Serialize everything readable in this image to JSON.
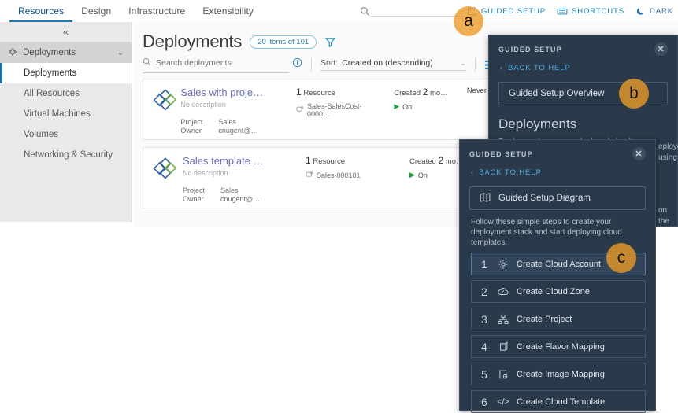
{
  "topnav": {
    "tabs": [
      {
        "label": "Resources",
        "active": true
      },
      {
        "label": "Design",
        "active": false
      },
      {
        "label": "Infrastructure",
        "active": false
      },
      {
        "label": "Extensibility",
        "active": false
      }
    ],
    "search_placeholder": "",
    "guided_setup_label": "GUIDED SETUP",
    "shortcuts_label": "SHORTCUTS",
    "dark_label": "DARK"
  },
  "sidebar": {
    "collapse_glyph": "«",
    "group": {
      "label": "Deployments",
      "caret": "⌄"
    },
    "items": [
      {
        "label": "Deployments",
        "active": true
      },
      {
        "label": "All Resources",
        "active": false
      },
      {
        "label": "Virtual Machines",
        "active": false
      },
      {
        "label": "Volumes",
        "active": false
      },
      {
        "label": "Networking & Security",
        "active": false
      }
    ]
  },
  "main": {
    "title": "Deployments",
    "count_pill": "20 items of 101",
    "search_placeholder": "Search deployments",
    "sort_label": "Sort:",
    "sort_value": "Created on (descending)",
    "cards": [
      {
        "title": "Sales with proje…",
        "description": "No description",
        "project_key": "Project",
        "project_value": "Sales",
        "owner_key": "Owner",
        "owner_value": "cnugent@…",
        "resource_count": "1",
        "resource_label": "Resource",
        "resource_name": "Sales-SalesCost-0000…",
        "created_label_pre": "Created",
        "created_value": "2",
        "created_label_post": "mo…",
        "power_state": "On",
        "expires": "Never exp"
      },
      {
        "title": "Sales template …",
        "description": "No description",
        "project_key": "Project",
        "project_value": "Sales",
        "owner_key": "Owner",
        "owner_value": "cnugent@…",
        "resource_count": "1",
        "resource_label": "Resource",
        "resource_name": "Sales-000101",
        "created_label_pre": "Created",
        "created_value": "2",
        "created_label_post": "mo…",
        "power_state": "On",
        "expires": ""
      }
    ]
  },
  "panel_b": {
    "header": "GUIDED SETUP",
    "close": "✕",
    "back": "BACK TO HELP",
    "overview_button": "Guided Setup Overview",
    "heading": "Deployments",
    "body": "Deployments are your deployed cloud"
  },
  "panel_c": {
    "header": "GUIDED SETUP",
    "close": "✕",
    "back": "BACK TO HELP",
    "diagram_button": "Guided Setup Diagram",
    "intro": "Follow these simple steps to create your deployment stack and start deploying cloud templates.",
    "steps": [
      {
        "num": "1",
        "label": "Create Cloud Account",
        "icon": "gear-icon",
        "highlight": true
      },
      {
        "num": "2",
        "label": "Create Cloud Zone",
        "icon": "cloud-icon",
        "highlight": false
      },
      {
        "num": "3",
        "label": "Create Project",
        "icon": "org-chart-icon",
        "highlight": false
      },
      {
        "num": "4",
        "label": "Create Flavor Mapping",
        "icon": "flavor-icon",
        "highlight": false
      },
      {
        "num": "5",
        "label": "Create Image Mapping",
        "icon": "image-gear-icon",
        "highlight": false
      },
      {
        "num": "6",
        "label": "Create Cloud Template",
        "icon": "code-icon",
        "highlight": false
      }
    ]
  },
  "background_fragments": {
    "frag1": "eployed",
    "frag2": "using",
    "frag3": "on the"
  },
  "markers": {
    "a": "a",
    "b": "b",
    "c": "c"
  },
  "colors": {
    "accent_blue": "#0f80c0",
    "panel_bg": "#2a3a4a",
    "marker_orange": "#d8922a",
    "sidebar_bg": "#e9e9e9",
    "card_title": "#6a6fc0",
    "status_green": "#1e9e3e"
  }
}
